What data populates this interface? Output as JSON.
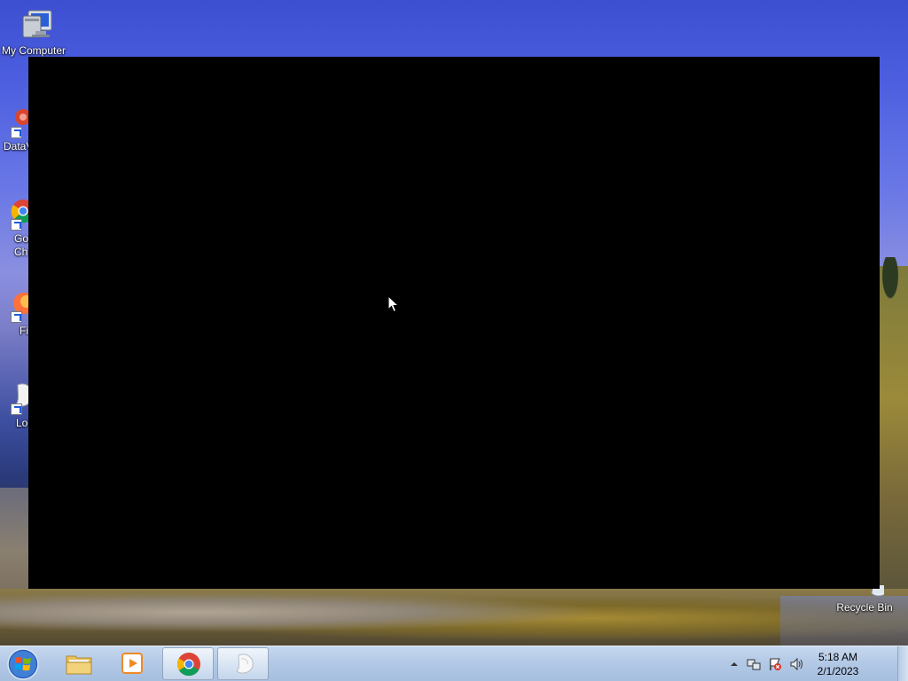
{
  "desktop": {
    "icons": [
      {
        "label": "My Computer",
        "glyph": "computer-icon"
      },
      {
        "label": "DataV",
        "glyph": "datav-icon"
      },
      {
        "label": "Go Ch",
        "glyph": "chrome-icon"
      },
      {
        "label": "Fi",
        "glyph": "firefox-icon"
      },
      {
        "label": "Lo",
        "glyph": "app-icon"
      },
      {
        "label": "Recycle Bin",
        "glyph": "recycle-bin-icon"
      }
    ]
  },
  "taskbar": {
    "start": "start-orb-icon",
    "pinned": [
      {
        "name": "file-explorer",
        "glyph": "folder-icon"
      },
      {
        "name": "media-player",
        "glyph": "media-player-icon"
      },
      {
        "name": "chrome",
        "glyph": "chrome-icon"
      },
      {
        "name": "app",
        "glyph": "app-icon"
      }
    ],
    "clock": {
      "time": "5:18 AM",
      "date": "2/1/2023"
    }
  },
  "colors": {
    "taskbar": "#b3c9e6",
    "window": "#000000"
  }
}
